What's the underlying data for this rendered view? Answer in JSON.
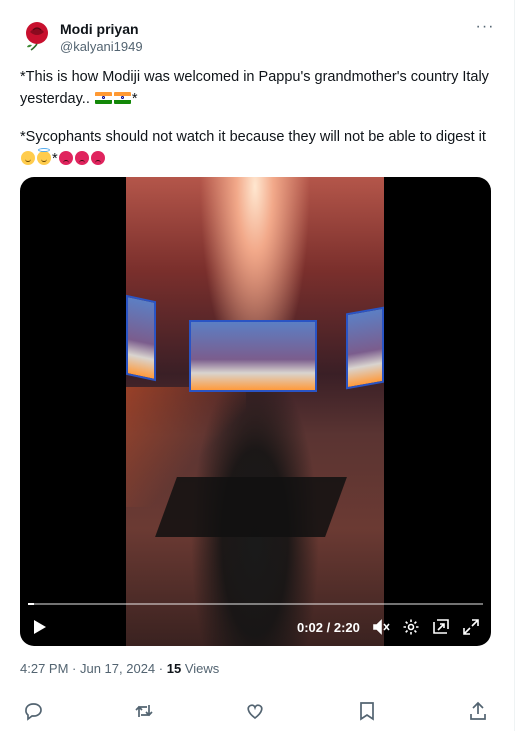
{
  "author": {
    "name": "Modi priyan",
    "handle": "@kalyani1949"
  },
  "tweet": {
    "line1": "*This is how Modiji was welcomed in Pappu's grandmother's country Italy yesterday..",
    "line1_end": "*",
    "line2": "*Sycophants should not watch it because they will not be able to digest it",
    "line2_mid": "*"
  },
  "video": {
    "time": "0:02 / 2:20",
    "progress": 0.014
  },
  "meta": {
    "time": "4:27 PM",
    "sep1": " · ",
    "date": "Jun 17, 2024",
    "sep2": " · ",
    "views_count": "15",
    "views_label": " Views"
  },
  "icons": {
    "more": "more-icon",
    "play": "play-icon",
    "mute": "mute-icon",
    "settings": "settings-icon",
    "pip": "pip-icon",
    "fullscreen": "fullscreen-icon",
    "reply": "reply-icon",
    "retweet": "retweet-icon",
    "like": "like-icon",
    "bookmark": "bookmark-icon",
    "share": "share-icon"
  },
  "colors": {
    "text": "#0f1419",
    "secondary": "#536471",
    "saffron": "#ff9933",
    "green": "#138808"
  }
}
